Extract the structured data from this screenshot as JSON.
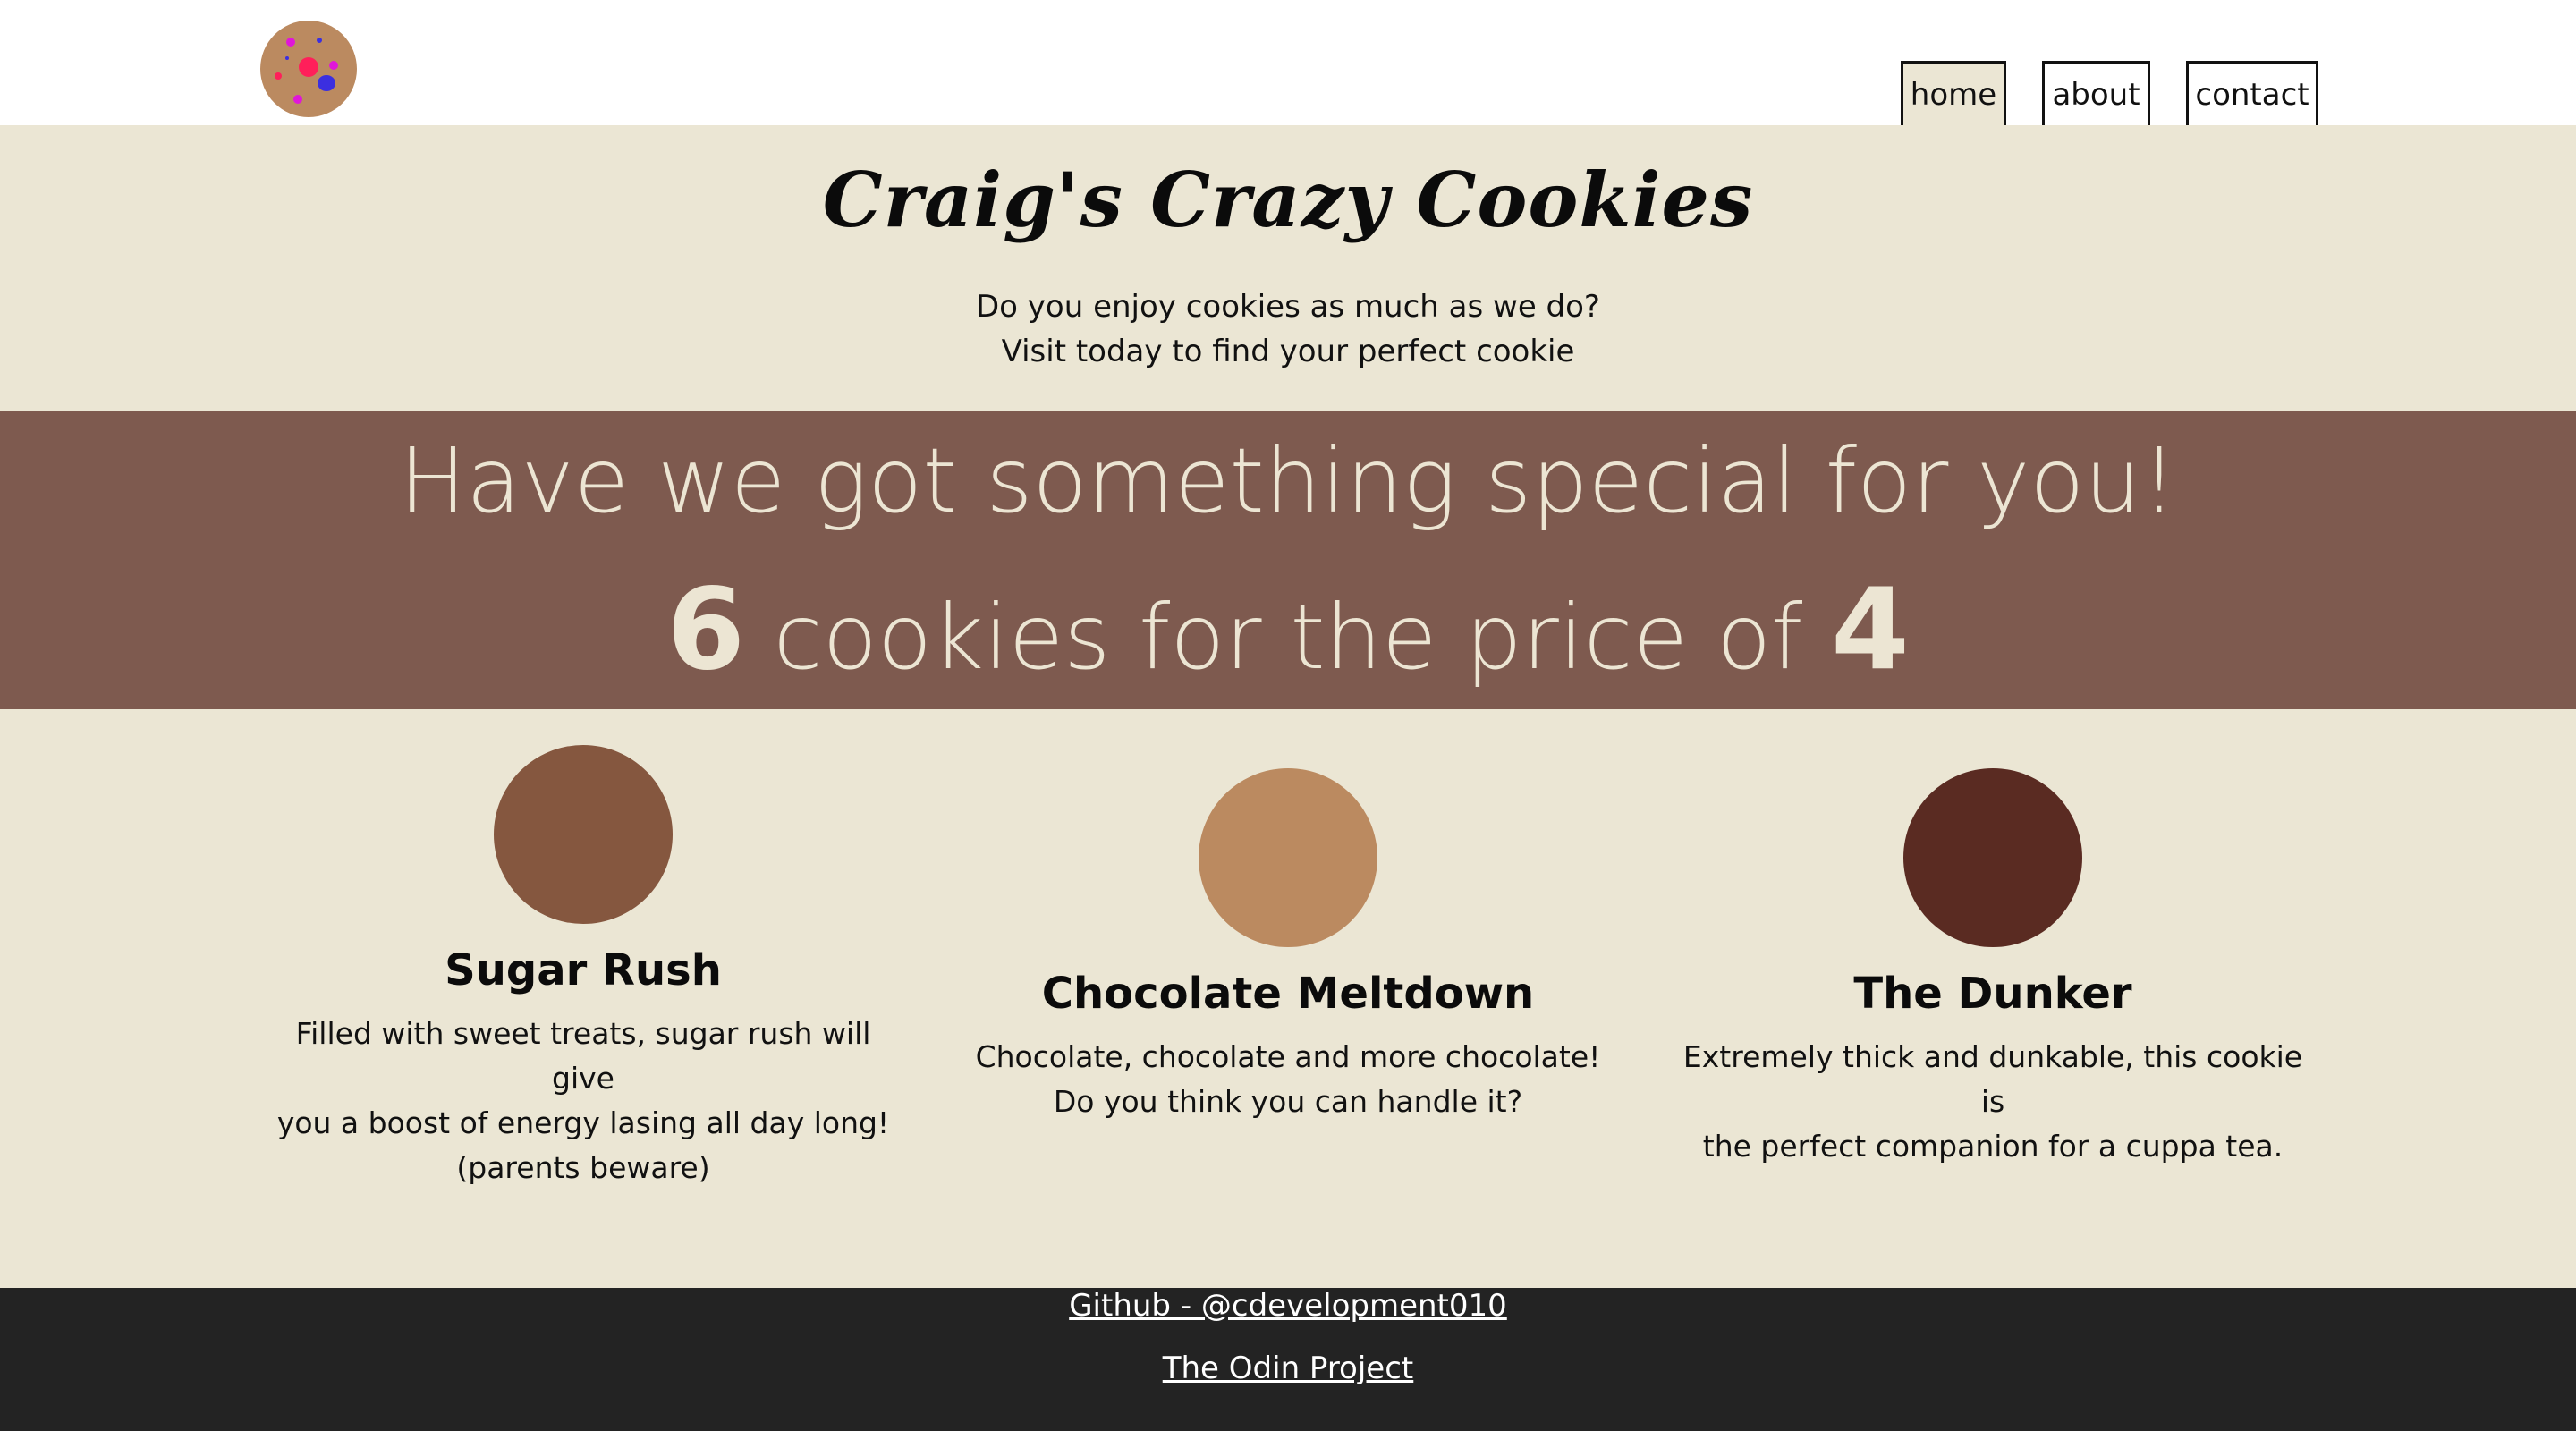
{
  "nav": {
    "items": [
      {
        "label": "home",
        "active": true
      },
      {
        "label": "about",
        "active": false
      },
      {
        "label": "contact",
        "active": false
      }
    ]
  },
  "hero": {
    "title": "Craig's Crazy Cookies",
    "intro_line1": "Do you enjoy cookies as much as we do?",
    "intro_line2": "Visit today to find your perfect cookie"
  },
  "promo": {
    "headline": "Have we got something special for you!",
    "offer_num1": "6",
    "offer_text": "cookies for the price of",
    "offer_num2": "4"
  },
  "cookies": [
    {
      "name": "Sugar Rush",
      "desc_lines": [
        "Filled with sweet treats, sugar rush will give",
        "you a boost of energy lasing all day long!",
        "(parents beware)"
      ],
      "color": "#85573f"
    },
    {
      "name": "Chocolate Meltdown",
      "desc_lines": [
        "Chocolate, chocolate and more chocolate!",
        "Do you think you can handle it?"
      ],
      "color": "#bb8a60"
    },
    {
      "name": "The Dunker",
      "desc_lines": [
        "Extremely thick and dunkable, this cookie is",
        "the perfect companion for a cuppa tea."
      ],
      "color": "#5a2b22"
    }
  ],
  "footer": {
    "github_link": "Github - @cdevelopment010",
    "odin_link": "The Odin Project"
  },
  "colors": {
    "page_bg": "#ebe6d4",
    "promo_bg": "#7e5a4f",
    "promo_text": "#ece5d3",
    "footer_bg": "#232323",
    "logo_cookie": "#bb8a60"
  }
}
